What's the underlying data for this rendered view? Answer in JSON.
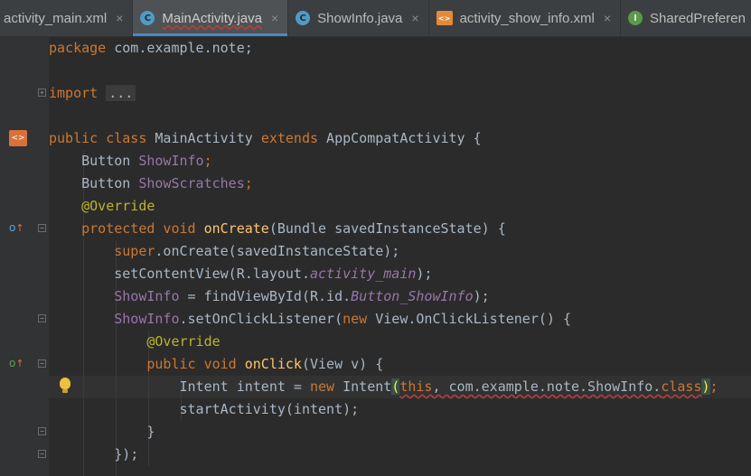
{
  "tabs": [
    {
      "label": "activity_main.xml",
      "icon": "xml-file-icon",
      "active": false
    },
    {
      "label": "MainActivity.java",
      "icon": "java-class-icon",
      "active": true
    },
    {
      "label": "ShowInfo.java",
      "icon": "java-class-icon",
      "active": false
    },
    {
      "label": "activity_show_info.xml",
      "icon": "xml-file-icon",
      "active": false
    },
    {
      "label": "SharedPreferen",
      "icon": "interface-icon",
      "active": false
    }
  ],
  "tab_close_glyph": "×",
  "code": {
    "l1": {
      "kw": "package",
      "rest": " com.example.note;"
    },
    "l3": {
      "kw": "import",
      "folded": "..."
    },
    "l5": {
      "kw1": "public class",
      "name": " MainActivity ",
      "kw2": "extends",
      "rest": " AppCompatActivity {"
    },
    "l6": {
      "type": "    Button ",
      "field": "ShowInfo",
      "end": ";"
    },
    "l7": {
      "type": "    Button ",
      "field": "ShowScratches",
      "end": ";"
    },
    "l8": {
      "ann": "    @Override"
    },
    "l9": {
      "kw": "    protected void ",
      "fn": "onCreate",
      "rest": "(Bundle savedInstanceState) {"
    },
    "l10": {
      "kw": "        super",
      "rest": ".onCreate(savedInstanceState);"
    },
    "l11": {
      "pre": "        setContentView(R.layout.",
      "it": "activity_main",
      "post": ");"
    },
    "l12": {
      "field": "        ShowInfo",
      "pre": " = findViewById(R.id.",
      "it": "Button_ShowInfo",
      "post": ");"
    },
    "l13": {
      "field": "        ShowInfo",
      "pre": ".setOnClickListener(",
      "kw": "new",
      "post": " View.OnClickListener() {"
    },
    "l14": {
      "ann": "            @Override"
    },
    "l15": {
      "kw": "            public void ",
      "fn": "onClick",
      "rest": "(View v) {"
    },
    "l16": {
      "pre": "                Intent intent = ",
      "kw": "new",
      "mid": " Intent",
      "p1": "(",
      "kw2": "this",
      "mid2": ", com.example.note.ShowInfo.",
      "kw3": "class",
      "p2": ")",
      "end": ";"
    },
    "l17": {
      "text": "                startActivity(intent);"
    },
    "l18": {
      "text": "            }"
    },
    "l19": {
      "text": "        });"
    }
  }
}
